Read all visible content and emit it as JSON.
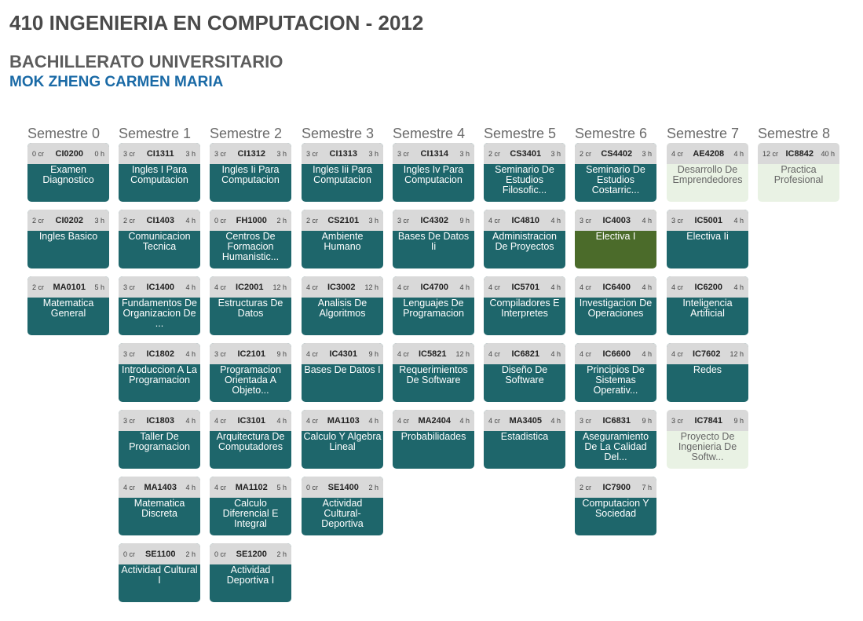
{
  "header": {
    "title": "410 INGENIERIA EN COMPUTACION - 2012",
    "subtitle": "BACHILLERATO UNIVERSITARIO",
    "student": "MOK ZHENG CARMEN MARIA"
  },
  "colors": {
    "course": "#1e666b",
    "completed_light": "#e9f2e4",
    "elective": "#4b6b2a",
    "header": "#d9d9d9",
    "student_name": "#1a6aa6"
  },
  "semesters": [
    {
      "title": "Semestre 0",
      "courses": [
        {
          "credits": "0 cr",
          "code": "CI0200",
          "hours": "0 h",
          "name": "Examen Diagnostico",
          "style": "dark"
        },
        {
          "credits": "2 cr",
          "code": "CI0202",
          "hours": "3 h",
          "name": "Ingles Basico",
          "style": "dark"
        },
        {
          "credits": "2 cr",
          "code": "MA0101",
          "hours": "5 h",
          "name": "Matematica General",
          "style": "dark"
        }
      ]
    },
    {
      "title": "Semestre 1",
      "courses": [
        {
          "credits": "3 cr",
          "code": "CI1311",
          "hours": "3 h",
          "name": "Ingles I Para Computacion",
          "style": "dark"
        },
        {
          "credits": "2 cr",
          "code": "CI1403",
          "hours": "4 h",
          "name": "Comunicacion Tecnica",
          "style": "dark"
        },
        {
          "credits": "3 cr",
          "code": "IC1400",
          "hours": "4 h",
          "name": "Fundamentos De Organizacion De ...",
          "style": "dark"
        },
        {
          "credits": "3 cr",
          "code": "IC1802",
          "hours": "4 h",
          "name": "Introduccion A La Programacion",
          "style": "dark"
        },
        {
          "credits": "3 cr",
          "code": "IC1803",
          "hours": "4 h",
          "name": "Taller De Programacion",
          "style": "dark"
        },
        {
          "credits": "4 cr",
          "code": "MA1403",
          "hours": "4 h",
          "name": "Matematica Discreta",
          "style": "dark"
        },
        {
          "credits": "0 cr",
          "code": "SE1100",
          "hours": "2 h",
          "name": "Actividad Cultural I",
          "style": "dark"
        }
      ]
    },
    {
      "title": "Semestre 2",
      "courses": [
        {
          "credits": "3 cr",
          "code": "CI1312",
          "hours": "3 h",
          "name": "Ingles Ii Para Computacion",
          "style": "dark"
        },
        {
          "credits": "0 cr",
          "code": "FH1000",
          "hours": "2 h",
          "name": "Centros De Formacion Humanistic...",
          "style": "dark"
        },
        {
          "credits": "4 cr",
          "code": "IC2001",
          "hours": "12 h",
          "name": "Estructuras De Datos",
          "style": "dark"
        },
        {
          "credits": "3 cr",
          "code": "IC2101",
          "hours": "9 h",
          "name": "Programacion Orientada A Objeto...",
          "style": "dark"
        },
        {
          "credits": "4 cr",
          "code": "IC3101",
          "hours": "4 h",
          "name": "Arquitectura De Computadores",
          "style": "dark"
        },
        {
          "credits": "4 cr",
          "code": "MA1102",
          "hours": "5 h",
          "name": "Calculo Diferencial E Integral",
          "style": "dark"
        },
        {
          "credits": "0 cr",
          "code": "SE1200",
          "hours": "2 h",
          "name": "Actividad Deportiva I",
          "style": "dark"
        }
      ]
    },
    {
      "title": "Semestre 3",
      "courses": [
        {
          "credits": "3 cr",
          "code": "CI1313",
          "hours": "3 h",
          "name": "Ingles Iii Para Computacion",
          "style": "dark"
        },
        {
          "credits": "2 cr",
          "code": "CS2101",
          "hours": "3 h",
          "name": "Ambiente Humano",
          "style": "dark"
        },
        {
          "credits": "4 cr",
          "code": "IC3002",
          "hours": "12 h",
          "name": "Analisis De Algoritmos",
          "style": "dark"
        },
        {
          "credits": "4 cr",
          "code": "IC4301",
          "hours": "9 h",
          "name": "Bases De Datos I",
          "style": "dark"
        },
        {
          "credits": "4 cr",
          "code": "MA1103",
          "hours": "4 h",
          "name": "Calculo Y Algebra Lineal",
          "style": "dark"
        },
        {
          "credits": "0 cr",
          "code": "SE1400",
          "hours": "2 h",
          "name": "Actividad Cultural-Deportiva",
          "style": "dark"
        }
      ]
    },
    {
      "title": "Semestre 4",
      "courses": [
        {
          "credits": "3 cr",
          "code": "CI1314",
          "hours": "3 h",
          "name": "Ingles Iv Para Computacion",
          "style": "dark"
        },
        {
          "credits": "3 cr",
          "code": "IC4302",
          "hours": "9 h",
          "name": "Bases De Datos Ii",
          "style": "dark"
        },
        {
          "credits": "4 cr",
          "code": "IC4700",
          "hours": "4 h",
          "name": "Lenguajes De Programacion",
          "style": "dark"
        },
        {
          "credits": "4 cr",
          "code": "IC5821",
          "hours": "12 h",
          "name": "Requerimientos De Software",
          "style": "dark"
        },
        {
          "credits": "4 cr",
          "code": "MA2404",
          "hours": "4 h",
          "name": "Probabilidades",
          "style": "dark"
        }
      ]
    },
    {
      "title": "Semestre 5",
      "courses": [
        {
          "credits": "2 cr",
          "code": "CS3401",
          "hours": "3 h",
          "name": "Seminario De Estudios Filosofic...",
          "style": "dark"
        },
        {
          "credits": "4 cr",
          "code": "IC4810",
          "hours": "4 h",
          "name": "Administracion De Proyectos",
          "style": "dark"
        },
        {
          "credits": "4 cr",
          "code": "IC5701",
          "hours": "4 h",
          "name": "Compiladores E Interpretes",
          "style": "dark"
        },
        {
          "credits": "4 cr",
          "code": "IC6821",
          "hours": "4 h",
          "name": "Diseño De Software",
          "style": "dark"
        },
        {
          "credits": "4 cr",
          "code": "MA3405",
          "hours": "4 h",
          "name": "Estadistica",
          "style": "dark"
        }
      ]
    },
    {
      "title": "Semestre 6",
      "courses": [
        {
          "credits": "2 cr",
          "code": "CS4402",
          "hours": "3 h",
          "name": "Seminario De Estudios Costarric...",
          "style": "dark"
        },
        {
          "credits": "3 cr",
          "code": "IC4003",
          "hours": "4 h",
          "name": "Electiva I",
          "style": "olive"
        },
        {
          "credits": "4 cr",
          "code": "IC6400",
          "hours": "4 h",
          "name": "Investigacion De Operaciones",
          "style": "dark"
        },
        {
          "credits": "4 cr",
          "code": "IC6600",
          "hours": "4 h",
          "name": "Principios De Sistemas Operativ...",
          "style": "dark"
        },
        {
          "credits": "3 cr",
          "code": "IC6831",
          "hours": "9 h",
          "name": "Aseguramiento De La Calidad Del...",
          "style": "dark"
        },
        {
          "credits": "2 cr",
          "code": "IC7900",
          "hours": "7 h",
          "name": "Computacion Y Sociedad",
          "style": "dark"
        }
      ]
    },
    {
      "title": "Semestre 7",
      "courses": [
        {
          "credits": "4 cr",
          "code": "AE4208",
          "hours": "4 h",
          "name": "Desarrollo De Emprendedores",
          "style": "light"
        },
        {
          "credits": "3 cr",
          "code": "IC5001",
          "hours": "4 h",
          "name": "Electiva Ii",
          "style": "dark"
        },
        {
          "credits": "4 cr",
          "code": "IC6200",
          "hours": "4 h",
          "name": "Inteligencia Artificial",
          "style": "dark"
        },
        {
          "credits": "4 cr",
          "code": "IC7602",
          "hours": "12 h",
          "name": "Redes",
          "style": "dark"
        },
        {
          "credits": "3 cr",
          "code": "IC7841",
          "hours": "9 h",
          "name": "Proyecto De Ingenieria De Softw...",
          "style": "light"
        }
      ]
    },
    {
      "title": "Semestre 8",
      "courses": [
        {
          "credits": "12 cr",
          "code": "IC8842",
          "hours": "40 h",
          "name": "Practica Profesional",
          "style": "light"
        }
      ]
    }
  ]
}
